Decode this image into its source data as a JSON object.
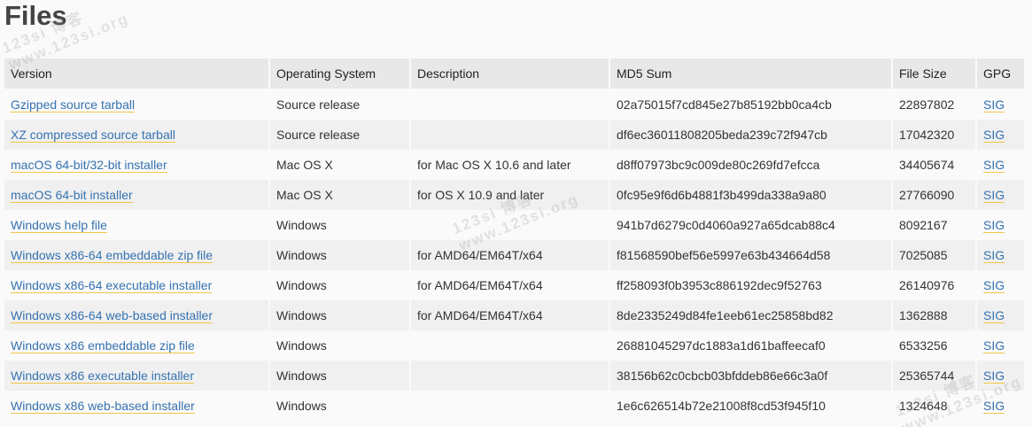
{
  "title": "Files",
  "headers": {
    "version": "Version",
    "os": "Operating System",
    "description": "Description",
    "md5": "MD5 Sum",
    "size": "File Size",
    "gpg": "GPG"
  },
  "rows": [
    {
      "version": "Gzipped source tarball",
      "os": "Source release",
      "description": "",
      "md5": "02a75015f7cd845e27b85192bb0ca4cb",
      "size": "22897802",
      "gpg": "SIG"
    },
    {
      "version": "XZ compressed source tarball",
      "os": "Source release",
      "description": "",
      "md5": "df6ec36011808205beda239c72f947cb",
      "size": "17042320",
      "gpg": "SIG"
    },
    {
      "version": "macOS 64-bit/32-bit installer",
      "os": "Mac OS X",
      "description": "for Mac OS X 10.6 and later",
      "md5": "d8ff07973bc9c009de80c269fd7efcca",
      "size": "34405674",
      "gpg": "SIG"
    },
    {
      "version": "macOS 64-bit installer",
      "os": "Mac OS X",
      "description": "for OS X 10.9 and later",
      "md5": "0fc95e9f6d6b4881f3b499da338a9a80",
      "size": "27766090",
      "gpg": "SIG"
    },
    {
      "version": "Windows help file",
      "os": "Windows",
      "description": "",
      "md5": "941b7d6279c0d4060a927a65dcab88c4",
      "size": "8092167",
      "gpg": "SIG"
    },
    {
      "version": "Windows x86-64 embeddable zip file",
      "os": "Windows",
      "description": "for AMD64/EM64T/x64",
      "md5": "f81568590bef56e5997e63b434664d58",
      "size": "7025085",
      "gpg": "SIG"
    },
    {
      "version": "Windows x86-64 executable installer",
      "os": "Windows",
      "description": "for AMD64/EM64T/x64",
      "md5": "ff258093f0b3953c886192dec9f52763",
      "size": "26140976",
      "gpg": "SIG"
    },
    {
      "version": "Windows x86-64 web-based installer",
      "os": "Windows",
      "description": "for AMD64/EM64T/x64",
      "md5": "8de2335249d84fe1eeb61ec25858bd82",
      "size": "1362888",
      "gpg": "SIG"
    },
    {
      "version": "Windows x86 embeddable zip file",
      "os": "Windows",
      "description": "",
      "md5": "26881045297dc1883a1d61baffeecaf0",
      "size": "6533256",
      "gpg": "SIG"
    },
    {
      "version": "Windows x86 executable installer",
      "os": "Windows",
      "description": "",
      "md5": "38156b62c0cbcb03bfddeb86e66c3a0f",
      "size": "25365744",
      "gpg": "SIG"
    },
    {
      "version": "Windows x86 web-based installer",
      "os": "Windows",
      "description": "",
      "md5": "1e6c626514b72e21008f8cd53f945f10",
      "size": "1324648",
      "gpg": "SIG"
    }
  ],
  "watermarks": [
    {
      "line1": "123si 博客",
      "line2": "www.123si.org"
    },
    {
      "line1": "123si 博客",
      "line2": "www.123si.org"
    },
    {
      "line1": "123si 博客",
      "line2": "www.123si.org"
    }
  ]
}
